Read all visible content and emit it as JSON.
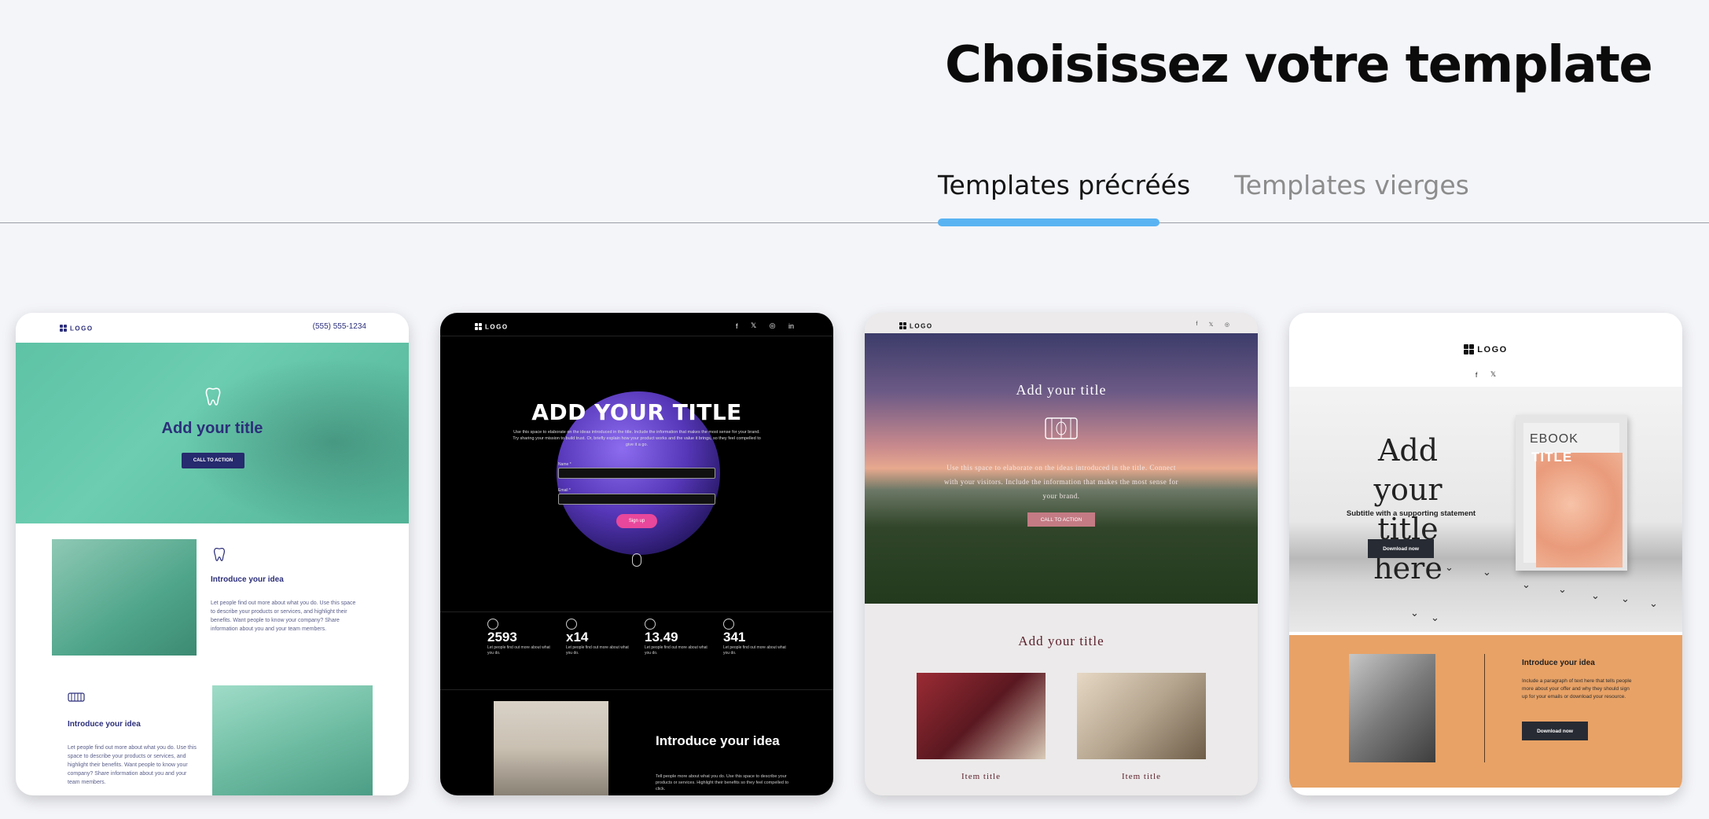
{
  "page": {
    "title": "Choisissez votre template",
    "tabs": [
      {
        "label": "Templates précréés",
        "active": true
      },
      {
        "label": "Templates vierges",
        "active": false
      }
    ],
    "accent_color": "#59b3f2"
  },
  "templates": [
    {
      "theme": "dental-teal",
      "logo": "LOGO",
      "phone": "(555) 555-1234",
      "hero_title": "Add your title",
      "cta": "CALL TO ACTION",
      "section1_title": "Introduce your idea",
      "section1_text": "Let people find out more about what you do. Use this space to describe your products or services, and highlight their benefits. Want people to know your company? Share information about you and your team members.",
      "section2_title": "Introduce your idea",
      "section2_text": "Let people find out more about what you do. Use this space to describe your products or services, and highlight their benefits. Want people to know your company? Share information about you and your team members.",
      "accent": "#5ec2a5"
    },
    {
      "theme": "space-dark",
      "logo": "LOGO",
      "hero_title": "ADD YOUR TITLE",
      "hero_text": "Use this space to elaborate on the ideas introduced in the title. Include the information that makes the most sense for your brand. Try sharing your mission to build trust. Or, briefly explain how your product works and the value it brings, so they feel compelled to give it a go.",
      "name_label": "Name *",
      "email_label": "Email *",
      "signup": "Sign up",
      "stats": [
        {
          "value": "2593",
          "desc": "Let people find out more about what you do."
        },
        {
          "value": "x14",
          "desc": "Let people find out more about what you do."
        },
        {
          "value": "13.49",
          "desc": "Let people find out more about what you do."
        },
        {
          "value": "341",
          "desc": "Let people find out more about what you do."
        }
      ],
      "section_title": "Introduce your idea",
      "section_text": "Tell people more about what you do. Use this space to describe your products or services. Highlight their benefits so they feel compelled to click.",
      "accent": "#e8479b"
    },
    {
      "theme": "vineyard",
      "logo": "LOGO",
      "hero_title": "Add your title",
      "hero_text": "Use this space to elaborate on the ideas introduced in the title. Connect with your visitors. Include the information that makes the most sense for your brand.",
      "cta": "CALL TO ACTION",
      "section_title": "Add your title",
      "items": [
        "Item title",
        "Item title"
      ],
      "accent": "#5a1f2b"
    },
    {
      "theme": "ebook-peach",
      "logo": "LOGO",
      "hero_title": "Add your title here",
      "subtitle": "Subtitle with a supporting statement",
      "button": "Download now",
      "ebook_label": "EBOOK",
      "ebook_title": "TITLE",
      "section_title": "Introduce your idea",
      "section_text": "Include a paragraph of text here that tells people more about your offer and why they should sign up for your emails or download your resource.",
      "button2": "Download now",
      "accent": "#e8a266"
    }
  ]
}
